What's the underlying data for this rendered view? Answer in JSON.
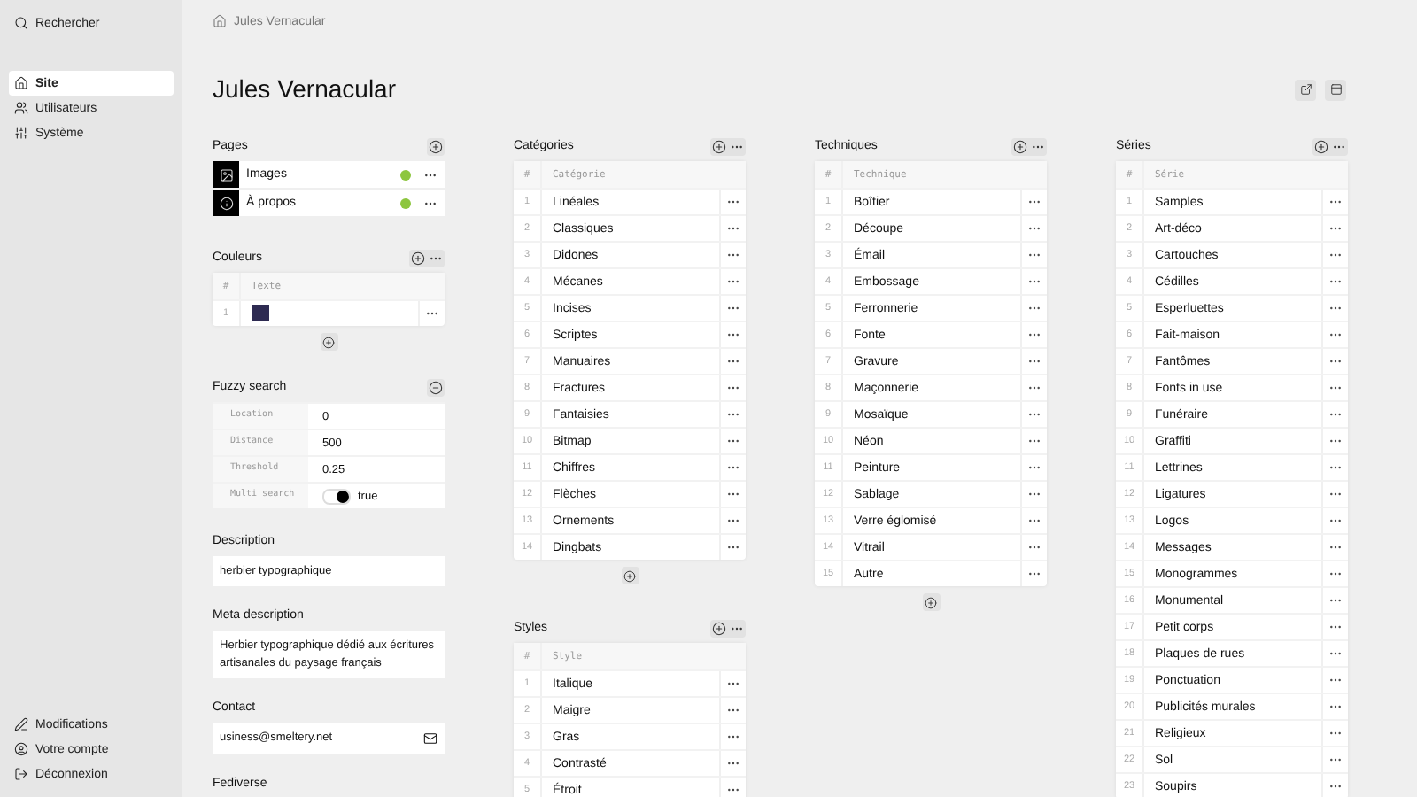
{
  "sidebar": {
    "search": "Rechercher",
    "items": [
      {
        "label": "Site",
        "selected": true
      },
      {
        "label": "Utilisateurs",
        "selected": false
      },
      {
        "label": "Système",
        "selected": false
      }
    ],
    "footer_items": [
      {
        "label": "Modifications"
      },
      {
        "label": "Votre compte"
      },
      {
        "label": "Déconnexion"
      }
    ]
  },
  "breadcrumb": "Jules Vernacular",
  "title": "Jules Vernacular",
  "pages": {
    "title": "Pages",
    "items": [
      {
        "label": "Images",
        "published": true
      },
      {
        "label": "À propos",
        "published": true
      }
    ]
  },
  "colors": {
    "title": "Couleurs",
    "columns": [
      "#",
      "Texte"
    ],
    "rows": [
      {
        "n": "1",
        "color": "#2e2b52"
      }
    ]
  },
  "fuzzy": {
    "title": "Fuzzy search",
    "fields": [
      {
        "kind": "text",
        "label": "Location",
        "value": "0"
      },
      {
        "kind": "text",
        "label": "Distance",
        "value": "500"
      },
      {
        "kind": "text",
        "label": "Threshold",
        "value": "0.25"
      },
      {
        "kind": "toggle",
        "label": "Multi search",
        "on": true,
        "value": "true"
      }
    ]
  },
  "fields": [
    {
      "label": "Description",
      "value": "herbier typographique",
      "kind": "text"
    },
    {
      "label": "Meta description",
      "value": "Herbier typographique dédié aux écritures artisanales du paysage français",
      "kind": "textarea"
    },
    {
      "label": "Contact",
      "value": "usiness@smeltery.net",
      "kind": "email"
    },
    {
      "label": "Fediverse",
      "kind": "fediverse"
    }
  ],
  "columns": [
    [
      {
        "title": "Catégories",
        "header": [
          "#",
          "Catégorie"
        ],
        "rows": [
          {
            "n": "1",
            "label": "Linéales"
          },
          {
            "n": "2",
            "label": "Classiques"
          },
          {
            "n": "3",
            "label": "Didones"
          },
          {
            "n": "4",
            "label": "Mécanes"
          },
          {
            "n": "5",
            "label": "Incises"
          },
          {
            "n": "6",
            "label": "Scriptes"
          },
          {
            "n": "7",
            "label": "Manuaires"
          },
          {
            "n": "8",
            "label": "Fractures"
          },
          {
            "n": "9",
            "label": "Fantaisies"
          },
          {
            "n": "10",
            "label": "Bitmap"
          },
          {
            "n": "11",
            "label": "Chiffres"
          },
          {
            "n": "12",
            "label": "Flèches"
          },
          {
            "n": "13",
            "label": "Ornements"
          },
          {
            "n": "14",
            "label": "Dingbats"
          }
        ]
      },
      {
        "title": "Styles",
        "header": [
          "#",
          "Style"
        ],
        "rows": [
          {
            "n": "1",
            "label": "Italique"
          },
          {
            "n": "2",
            "label": "Maigre"
          },
          {
            "n": "3",
            "label": "Gras"
          },
          {
            "n": "4",
            "label": "Contrasté"
          },
          {
            "n": "5",
            "label": "Étroit"
          }
        ]
      }
    ],
    [
      {
        "title": "Techniques",
        "header": [
          "#",
          "Technique"
        ],
        "rows": [
          {
            "n": "1",
            "label": "Boîtier"
          },
          {
            "n": "2",
            "label": "Découpe"
          },
          {
            "n": "3",
            "label": "Émail"
          },
          {
            "n": "4",
            "label": "Embossage"
          },
          {
            "n": "5",
            "label": "Ferronnerie"
          },
          {
            "n": "6",
            "label": "Fonte"
          },
          {
            "n": "7",
            "label": "Gravure"
          },
          {
            "n": "8",
            "label": "Maçonnerie"
          },
          {
            "n": "9",
            "label": "Mosaïque"
          },
          {
            "n": "10",
            "label": "Néon"
          },
          {
            "n": "11",
            "label": "Peinture"
          },
          {
            "n": "12",
            "label": "Sablage"
          },
          {
            "n": "13",
            "label": "Verre églomisé"
          },
          {
            "n": "14",
            "label": "Vitrail"
          },
          {
            "n": "15",
            "label": "Autre"
          }
        ]
      }
    ],
    [
      {
        "title": "Séries",
        "header": [
          "#",
          "Série"
        ],
        "rows": [
          {
            "n": "1",
            "label": "Samples"
          },
          {
            "n": "2",
            "label": "Art-déco"
          },
          {
            "n": "3",
            "label": "Cartouches"
          },
          {
            "n": "4",
            "label": "Cédilles"
          },
          {
            "n": "5",
            "label": "Esperluettes"
          },
          {
            "n": "6",
            "label": "Fait-maison"
          },
          {
            "n": "7",
            "label": "Fantômes"
          },
          {
            "n": "8",
            "label": "Fonts in use"
          },
          {
            "n": "9",
            "label": "Funéraire"
          },
          {
            "n": "10",
            "label": "Graffiti"
          },
          {
            "n": "11",
            "label": "Lettrines"
          },
          {
            "n": "12",
            "label": "Ligatures"
          },
          {
            "n": "13",
            "label": "Logos"
          },
          {
            "n": "14",
            "label": "Messages"
          },
          {
            "n": "15",
            "label": "Monogrammes"
          },
          {
            "n": "16",
            "label": "Monumental"
          },
          {
            "n": "17",
            "label": "Petit corps"
          },
          {
            "n": "18",
            "label": "Plaques de rues"
          },
          {
            "n": "19",
            "label": "Ponctuation"
          },
          {
            "n": "20",
            "label": "Publicités murales"
          },
          {
            "n": "21",
            "label": "Religieux"
          },
          {
            "n": "22",
            "label": "Sol"
          },
          {
            "n": "23",
            "label": "Soupirs"
          }
        ]
      }
    ]
  ]
}
